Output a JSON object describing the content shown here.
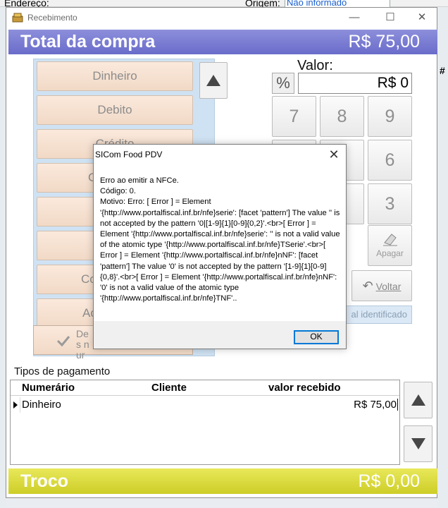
{
  "background": {
    "field_label_1": "Endereço:",
    "field_label_2": "Origem:",
    "origem_value": "Não informado",
    "right_col_header": "#"
  },
  "window": {
    "title": "Recebimento",
    "minimize": "—",
    "maximize": "☐",
    "close": "✕"
  },
  "total": {
    "label": "Total da compra",
    "value": "R$ 75,00"
  },
  "payment_buttons": [
    "Dinheiro",
    "Debito",
    "Crédito",
    "C",
    "",
    "",
    "Co",
    "Ac"
  ],
  "desmarcar_label": "Des nur",
  "valor": {
    "label": "Valor:",
    "percent_label": "%",
    "value": "R$ 0"
  },
  "keypad": [
    "7",
    "8",
    "9",
    "",
    "",
    "6",
    "",
    "",
    "3"
  ],
  "apagar_label": "Apagar",
  "voltar_label": "Voltar",
  "identificado_label": "al identificado",
  "tipos": {
    "label": "Tipos de pagamento",
    "columns": [
      "Numerário",
      "Cliente",
      "valor recebido"
    ],
    "rows": [
      {
        "numerario": "Dinheiro",
        "cliente": "",
        "valor": "R$ 75,00"
      }
    ]
  },
  "troco": {
    "label": "Troco",
    "value": "R$ 0,00"
  },
  "dialog": {
    "title": "SICom Food PDV",
    "close": "✕",
    "message": "Erro ao emitir a NFCe.\nCódigo: 0.\nMotivo: Erro: [ Error ] = Element '{http://www.portalfiscal.inf.br/nfe}serie': [facet 'pattern'] The value '' is not accepted by the pattern '0|[1-9]{1}[0-9]{0,2}'.<br>[ Error ] = Element '{http://www.portalfiscal.inf.br/nfe}serie': '' is not a valid value of the atomic type '{http://www.portalfiscal.inf.br/nfe}TSerie'.<br>[ Error ] = Element '{http://www.portalfiscal.inf.br/nfe}nNF': [facet 'pattern'] The value '0' is not accepted by the pattern '[1-9]{1}[0-9]{0,8}'.<br>[ Error ] = Element '{http://www.portalfiscal.inf.br/nfe}nNF': '0' is not a valid value of the atomic type '{http://www.portalfiscal.inf.br/nfe}TNF'..",
    "ok_label": "OK"
  },
  "colors": {
    "total_bar": "#7577cf",
    "troco_bar": "#d6d63a",
    "payment_button": "#f6e1d0",
    "panel": "#cfe2f3"
  }
}
